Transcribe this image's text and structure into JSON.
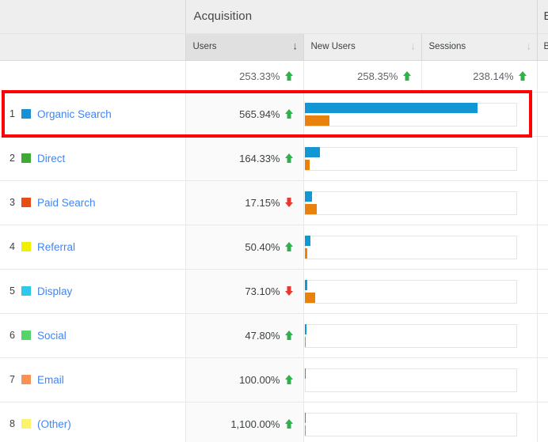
{
  "header": {
    "group_acquisition": "Acquisition",
    "group_behavior": "B",
    "columns": [
      {
        "label": "Users",
        "sort_arrow": "↓",
        "sorted": true
      },
      {
        "label": "New Users",
        "sort_arrow": "↓",
        "sorted": false
      },
      {
        "label": "Sessions",
        "sort_arrow": "↓",
        "sorted": false
      }
    ],
    "behavior_column_label": "B"
  },
  "totals": {
    "users": {
      "pct": "253.33%",
      "direction": "up"
    },
    "new_users": {
      "pct": "258.35%",
      "direction": "up"
    },
    "sessions": {
      "pct": "238.14%",
      "direction": "up"
    }
  },
  "colors": {
    "primary_bar": "#1296d4",
    "secondary_bar": "#e8820c",
    "delta_up": "#30b14a",
    "delta_down": "#e8392f",
    "link": "#4285f4",
    "highlight_outline": "#ff0000"
  },
  "rows": [
    {
      "rank": "1",
      "label": "Organic Search",
      "swatch": "#1a8fd4",
      "users_pct": "565.94%",
      "users_dir": "up",
      "bar_primary_pct": 82,
      "bar_secondary_pct": 12,
      "highlighted": true
    },
    {
      "rank": "2",
      "label": "Direct",
      "swatch": "#3eaa35",
      "users_pct": "164.33%",
      "users_dir": "up",
      "bar_primary_pct": 7.5,
      "bar_secondary_pct": 2.6,
      "highlighted": false
    },
    {
      "rank": "3",
      "label": "Paid Search",
      "swatch": "#e84d18",
      "users_pct": "17.15%",
      "users_dir": "down",
      "bar_primary_pct": 3.4,
      "bar_secondary_pct": 5.7,
      "highlighted": false
    },
    {
      "rank": "4",
      "label": "Referral",
      "swatch": "#f0f000",
      "users_pct": "50.40%",
      "users_dir": "up",
      "bar_primary_pct": 2.8,
      "bar_secondary_pct": 1.4,
      "highlighted": false
    },
    {
      "rank": "5",
      "label": "Display",
      "swatch": "#2ec8ea",
      "users_pct": "73.10%",
      "users_dir": "down",
      "bar_primary_pct": 1.3,
      "bar_secondary_pct": 5.2,
      "highlighted": false
    },
    {
      "rank": "6",
      "label": "Social",
      "swatch": "#55d46a",
      "users_pct": "47.80%",
      "users_dir": "up",
      "bar_primary_pct": 0.9,
      "bar_secondary_pct": 0.7,
      "highlighted": false
    },
    {
      "rank": "7",
      "label": "Email",
      "swatch": "#f89355",
      "users_pct": "100.00%",
      "users_dir": "up",
      "bar_primary_pct": 0.6,
      "bar_secondary_pct": 0,
      "highlighted": false
    },
    {
      "rank": "8",
      "label": "(Other)",
      "swatch": "#fbf26e",
      "users_pct": "1,100.00%",
      "users_dir": "up",
      "bar_primary_pct": 0.5,
      "bar_secondary_pct": 0.45,
      "highlighted": false
    }
  ],
  "chart_data": {
    "type": "bar",
    "title": "Acquisition",
    "categories": [
      "Organic Search",
      "Direct",
      "Paid Search",
      "Referral",
      "Display",
      "Social",
      "Email",
      "(Other)"
    ],
    "series": [
      {
        "name": "New Users",
        "values": [
          82,
          7.5,
          3.4,
          2.8,
          1.3,
          0.9,
          0.6,
          0.5
        ]
      },
      {
        "name": "Sessions",
        "values": [
          12,
          2.6,
          5.7,
          1.4,
          5.2,
          0.7,
          0,
          0.45
        ]
      }
    ],
    "xlabel": "",
    "ylabel": "",
    "xlim": [
      0,
      100
    ],
    "grid": false,
    "legend": "none",
    "users_change_pct": [
      565.94,
      164.33,
      17.15,
      50.4,
      73.1,
      47.8,
      100.0,
      1100.0
    ],
    "users_change_direction": [
      "up",
      "up",
      "down",
      "up",
      "down",
      "up",
      "up",
      "up"
    ],
    "totals": {
      "users": 253.33,
      "new_users": 258.35,
      "sessions": 238.14
    }
  }
}
